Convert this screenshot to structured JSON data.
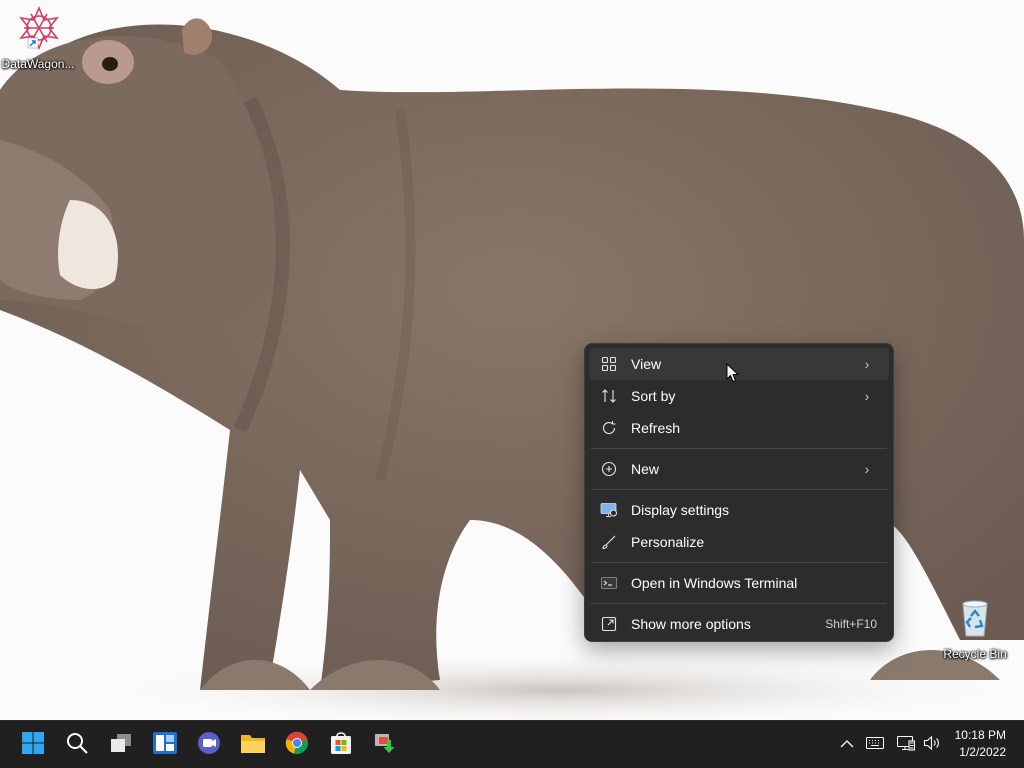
{
  "desktop": {
    "icons": [
      {
        "label": "DataWagon..."
      },
      {
        "label": "Recycle Bin"
      }
    ]
  },
  "context_menu": {
    "items": [
      {
        "label": "View",
        "icon": "grid-icon",
        "submenu": true
      },
      {
        "label": "Sort by",
        "icon": "sort-icon",
        "submenu": true
      },
      {
        "label": "Refresh",
        "icon": "refresh-icon",
        "submenu": false
      },
      {
        "label": "New",
        "icon": "plus-circle-icon",
        "submenu": true
      },
      {
        "label": "Display settings",
        "icon": "display-icon",
        "submenu": false
      },
      {
        "label": "Personalize",
        "icon": "brush-icon",
        "submenu": false
      },
      {
        "label": "Open in Windows Terminal",
        "icon": "terminal-icon",
        "submenu": false
      },
      {
        "label": "Show more options",
        "icon": "expand-icon",
        "shortcut": "Shift+F10"
      }
    ],
    "hovered": "View"
  },
  "taskbar": {
    "apps": [
      "start-icon",
      "search-icon",
      "task-view-icon",
      "widgets-icon",
      "chat-icon",
      "file-explorer-icon",
      "chrome-icon",
      "store-icon",
      "app-installer-icon"
    ],
    "clock": {
      "time": "10:18 PM",
      "date": "1/2/2022"
    }
  },
  "colors": {
    "menu_bg": "#2c2c2c",
    "menu_hover": "#383838",
    "taskbar_bg": "#202020",
    "accent": "#0078d4"
  }
}
